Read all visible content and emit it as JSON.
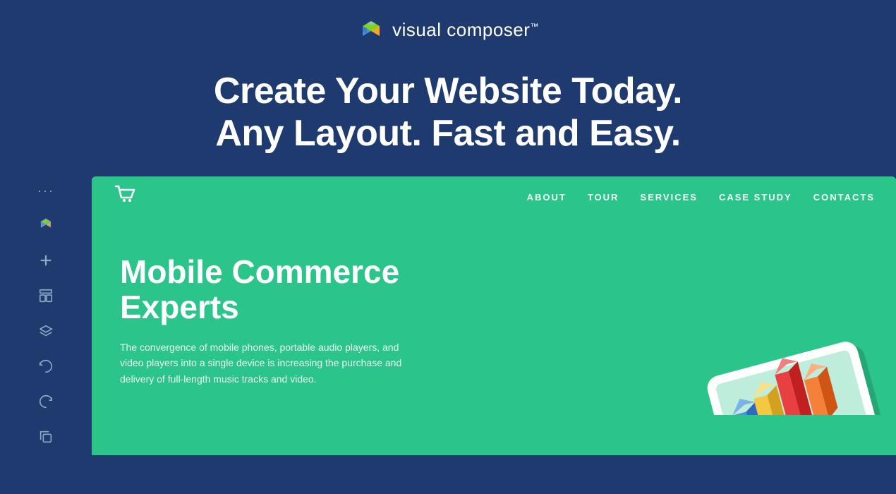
{
  "header": {
    "logo_text": "visual composer",
    "trademark": "™"
  },
  "hero": {
    "line1": "Create Your Website Today.",
    "line2": "Any Layout. Fast and Easy."
  },
  "sidebar": {
    "icons": [
      "dots",
      "logo",
      "plus",
      "template",
      "layers",
      "undo",
      "redo",
      "copy"
    ]
  },
  "preview": {
    "nav": {
      "logo_icon": "cart",
      "links": [
        "ABOUT",
        "TOUR",
        "SERVICES",
        "CASE STUDY",
        "CONTACTS"
      ]
    },
    "hero": {
      "heading_line1": "Mobile Commerce",
      "heading_line2": "Experts",
      "body_text": "The convergence of mobile phones, portable audio players, and video players into a single device is increasing the purchase and delivery of full-length music tracks and video."
    }
  },
  "colors": {
    "background": "#1e3a6e",
    "preview_bg": "#2bc48a",
    "white": "#ffffff",
    "sidebar_icon": "#7a9abd"
  }
}
